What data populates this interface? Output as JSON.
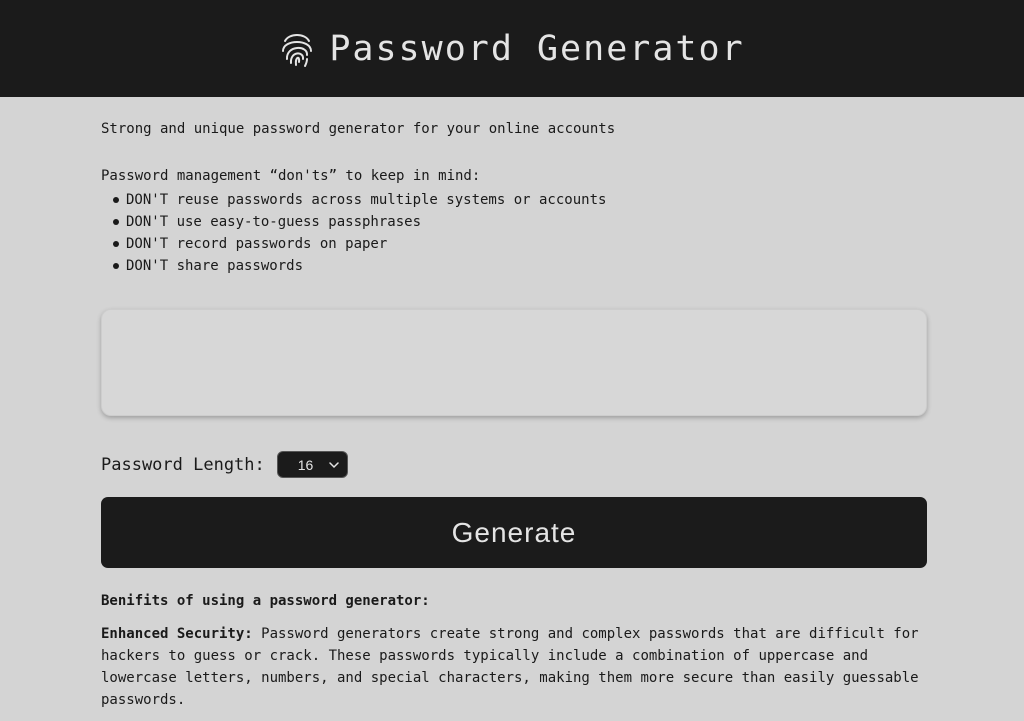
{
  "header": {
    "title": "Password Generator",
    "icon": "fingerprint-icon"
  },
  "intro": {
    "tagline": "Strong and unique password generator for your online accounts",
    "donts_heading": "Password management “don'ts” to keep in mind:",
    "donts": [
      "DON'T reuse passwords across multiple systems or accounts",
      "DON'T use easy-to-guess passphrases",
      "DON'T record passwords on paper",
      "DON'T share passwords"
    ]
  },
  "output": {
    "value": ""
  },
  "controls": {
    "length_label": "Password Length:",
    "length_value": "16",
    "generate_label": "Generate"
  },
  "benefits": {
    "heading": "Benifits of using a password generator:",
    "items": [
      {
        "term": "Enhanced Security:",
        "text": " Password generators create strong and complex passwords that are difficult for hackers to guess or crack. These passwords typically include a combination of uppercase and lowercase letters, numbers, and special characters, making them more secure than easily guessable passwords."
      }
    ]
  },
  "colors": {
    "header_bg": "#1b1b1b",
    "page_bg": "#d4d4d4",
    "button_bg": "#1b1b1b",
    "light_text": "#e4e4e4"
  }
}
